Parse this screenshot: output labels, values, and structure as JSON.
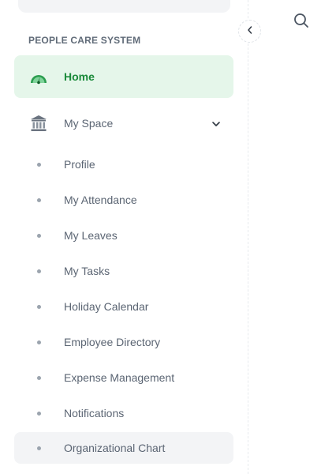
{
  "sidebar": {
    "section_label": "PEOPLE CARE SYSTEM",
    "home": {
      "label": "Home",
      "icon": "gauge-icon",
      "color": "#1a8a3a"
    },
    "my_space": {
      "label": "My Space",
      "icon": "bank-icon",
      "expanded": true,
      "items": [
        {
          "label": "Profile"
        },
        {
          "label": "My Attendance"
        },
        {
          "label": "My Leaves"
        },
        {
          "label": "My Tasks"
        },
        {
          "label": "Holiday Calendar"
        },
        {
          "label": "Employee Directory"
        },
        {
          "label": "Expense Management"
        },
        {
          "label": "Notifications"
        },
        {
          "label": "Organizational Chart"
        }
      ]
    }
  },
  "header": {
    "search_icon": "search-icon",
    "collapse_icon": "chevron-left-icon"
  },
  "colors": {
    "active_bg": "#e5f6ea",
    "active_text": "#1a8a3a",
    "hover_bg": "#f3f4f6"
  }
}
